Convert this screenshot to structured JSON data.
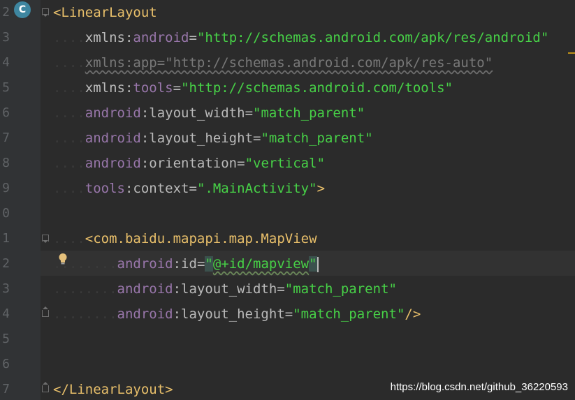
{
  "gutter": {
    "line_numbers": [
      "2",
      "3",
      "4",
      "5",
      "6",
      "7",
      "8",
      "9",
      "0",
      "1",
      "2",
      "3",
      "4",
      "5",
      "6",
      "7"
    ]
  },
  "badge": {
    "letter": "C"
  },
  "code": {
    "l1": {
      "open": "<",
      "tag": "LinearLayout"
    },
    "l2": {
      "ns": "xmlns",
      "colon": ":",
      "attr": "android",
      "eq": "=",
      "q1": "\"",
      "val": "http://schemas.android.com/apk/res/android",
      "q2": "\""
    },
    "l3": {
      "text": "xmlns:app=\"http://schemas.android.com/apk/res-auto\""
    },
    "l4": {
      "ns": "xmlns",
      "colon": ":",
      "attr": "tools",
      "eq": "=",
      "q1": "\"",
      "val": "http://schemas.android.com/tools",
      "q2": "\""
    },
    "l5": {
      "ns": "android",
      "colon": ":",
      "attr": "layout_width",
      "eq": "=",
      "q1": "\"",
      "val": "match_parent",
      "q2": "\""
    },
    "l6": {
      "ns": "android",
      "colon": ":",
      "attr": "layout_height",
      "eq": "=",
      "q1": "\"",
      "val": "match_parent",
      "q2": "\""
    },
    "l7": {
      "ns": "android",
      "colon": ":",
      "attr": "orientation",
      "eq": "=",
      "q1": "\"",
      "val": "vertical",
      "q2": "\""
    },
    "l8": {
      "ns": "tools",
      "colon": ":",
      "attr": "context",
      "eq": "=",
      "q1": "\"",
      "val": ".MainActivity",
      "q2": "\"",
      "close": ">"
    },
    "l10": {
      "open": "<",
      "tag": "com.baidu.mapapi.map.MapView"
    },
    "l11": {
      "ns": "android",
      "colon": ":",
      "attr": "id",
      "eq": "=",
      "q1": "\"",
      "val": "@+id/mapview",
      "q2": "\""
    },
    "l12": {
      "ns": "android",
      "colon": ":",
      "attr": "layout_width",
      "eq": "=",
      "q1": "\"",
      "val": "match_parent",
      "q2": "\""
    },
    "l13": {
      "ns": "android",
      "colon": ":",
      "attr": "layout_height",
      "eq": "=",
      "q1": "\"",
      "val": "match_parent",
      "q2": "\"",
      "close": "/>"
    },
    "l16": {
      "open": "</",
      "tag": "LinearLayout",
      "close": ">"
    }
  },
  "watermark": "https://blog.csdn.net/github_36220593",
  "colors": {
    "background": "#2b2b2b",
    "gutter": "#313335",
    "tag": "#e8bf6a",
    "namespace": "#9876aa",
    "value": "#47d147"
  }
}
